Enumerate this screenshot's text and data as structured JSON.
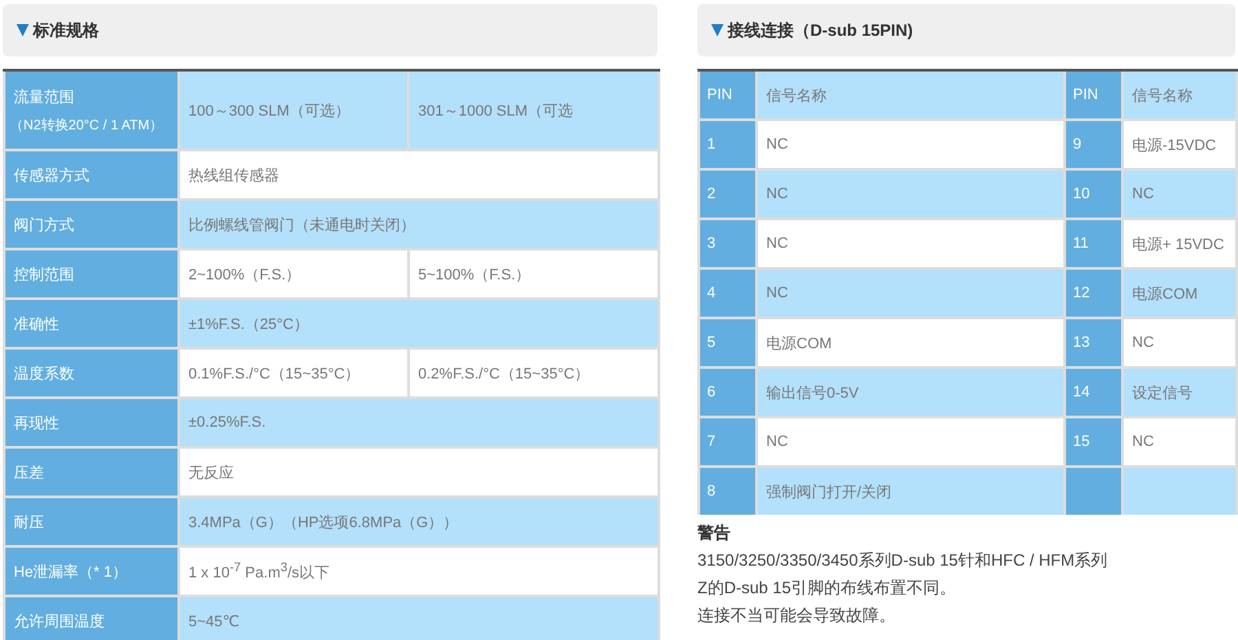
{
  "spec_panel": {
    "title": "标准规格",
    "rows": [
      {
        "label": "流量范围",
        "sublabel": "（N2转换20°C / 1 ATM）",
        "values": [
          "100～300 SLM（可选）",
          "301～1000 SLM（可选"
        ]
      },
      {
        "label": "传感器方式",
        "values": [
          "热线组传感器"
        ]
      },
      {
        "label": "阀门方式",
        "values": [
          "比例螺线管阀门（未通电时关闭）"
        ]
      },
      {
        "label": "控制范围",
        "values": [
          "2~100%（F.S.）",
          "5~100%（F.S.）"
        ]
      },
      {
        "label": "准确性",
        "values": [
          "±1%F.S.（25°C）"
        ]
      },
      {
        "label": "温度系数",
        "values": [
          "0.1%F.S./°C（15~35°C）",
          "0.2%F.S./°C（15~35°C）"
        ]
      },
      {
        "label": "再现性",
        "values": [
          "±0.25%F.S."
        ]
      },
      {
        "label": "压差",
        "values": [
          "无反应"
        ]
      },
      {
        "label": "耐压",
        "values": [
          "3.4MPa（G）（HP选项6.8MPa（G））"
        ]
      },
      {
        "label": "He泄漏率（* 1）",
        "values": [
          "1 x 10$^{-7}$ Pa.m$^{3}$/s以下"
        ]
      },
      {
        "label": "允许周围温度",
        "values": [
          "5~45℃"
        ]
      }
    ]
  },
  "pin_panel": {
    "title": "接线连接（D-sub 15PIN)",
    "header": [
      "PIN",
      "信号名称",
      "PIN",
      "信号名称"
    ],
    "rows": [
      [
        "1",
        "NC",
        "9",
        "电源-15VDC"
      ],
      [
        "2",
        "NC",
        "10",
        "NC"
      ],
      [
        "3",
        "NC",
        "11",
        "电源+ 15VDC"
      ],
      [
        "4",
        "NC",
        "12",
        "电源COM"
      ],
      [
        "5",
        "电源COM",
        "13",
        "NC"
      ],
      [
        "6",
        "输出信号0-5V",
        "14",
        "设定信号"
      ],
      [
        "7",
        "NC",
        "15",
        "NC"
      ],
      [
        "8",
        "强制阀门打开/关闭",
        "",
        ""
      ]
    ],
    "warning_title": "警告",
    "warning_lines": [
      "3150/3250/3350/3450系列D-sub 15针和HFC / HFM系列",
      "Z的D-sub 15引脚的布线布置不同。",
      "连接不当可能会导致故障。"
    ]
  }
}
